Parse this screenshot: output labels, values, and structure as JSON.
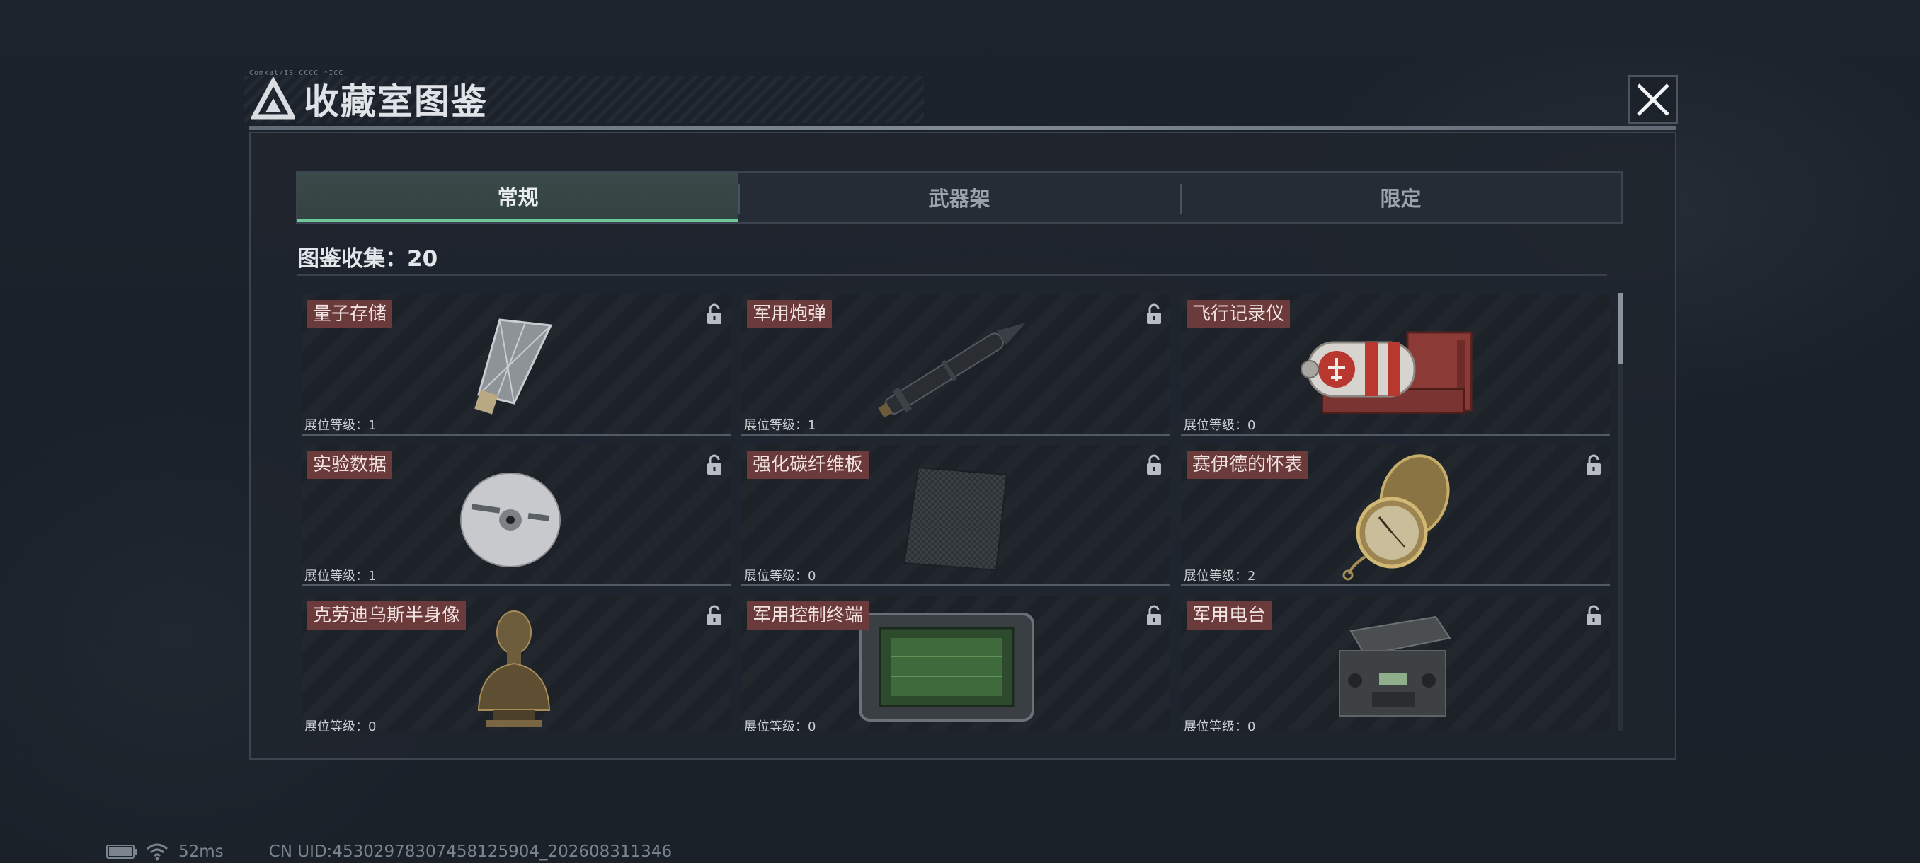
{
  "header": {
    "title": "收藏室图鉴",
    "caption": "Comkat/IS CCCC *ICC"
  },
  "tabs": [
    {
      "label": "常规",
      "active": true
    },
    {
      "label": "武器架",
      "active": false
    },
    {
      "label": "限定",
      "active": false
    }
  ],
  "collection": {
    "label": "图鉴收集：",
    "count": "20"
  },
  "items": [
    {
      "name": "量子存储",
      "level_label": "展位等级：",
      "level": "1",
      "icon": "quantum-storage-drive"
    },
    {
      "name": "军用炮弹",
      "level_label": "展位等级：",
      "level": "1",
      "icon": "artillery-shell"
    },
    {
      "name": "飞行记录仪",
      "level_label": "展位等级：",
      "level": "0",
      "icon": "flight-recorder"
    },
    {
      "name": "实验数据",
      "level_label": "展位等级：",
      "level": "1",
      "icon": "data-disc"
    },
    {
      "name": "强化碳纤维板",
      "level_label": "展位等级：",
      "level": "0",
      "icon": "carbon-fiber-plate"
    },
    {
      "name": "赛伊德的怀表",
      "level_label": "展位等级：",
      "level": "2",
      "icon": "pocket-watch"
    },
    {
      "name": "克劳迪乌斯半身像",
      "level_label": "展位等级：",
      "level": "0",
      "icon": "bust-statue"
    },
    {
      "name": "军用控制终端",
      "level_label": "展位等级：",
      "level": "0",
      "icon": "control-terminal"
    },
    {
      "name": "军用电台",
      "level_label": "展位等级：",
      "level": "0",
      "icon": "military-radio"
    }
  ],
  "status": {
    "ping": "52ms",
    "uid": "CN UID:4530297830745812590​4_202608311346"
  },
  "colors": {
    "accent_green": "#6fc79a",
    "label_bg": "#6b3a3a"
  }
}
